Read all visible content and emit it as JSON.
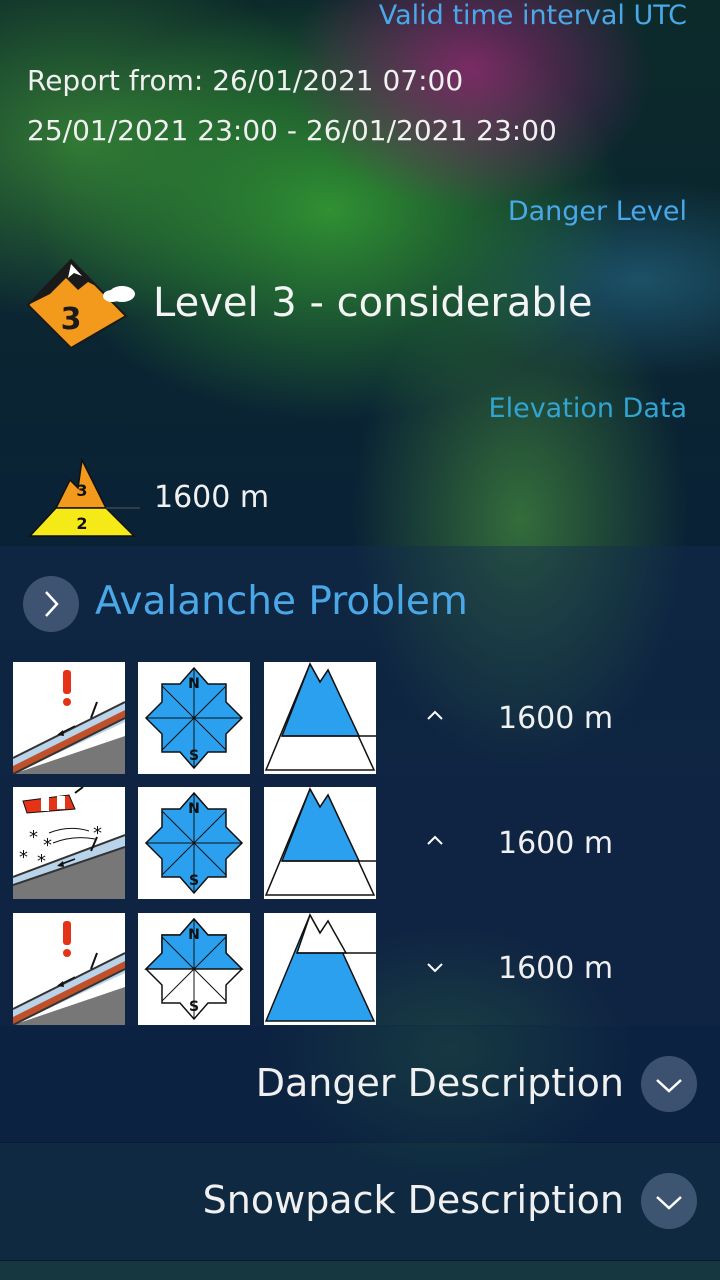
{
  "header": {
    "valid_interval_link": "Valid time interval UTC",
    "report_from": "Report from: 26/01/2021 07:00",
    "interval": "25/01/2021 23:00 - 26/01/2021 23:00",
    "danger_level_link": "Danger Level",
    "danger_level_number": "3",
    "danger_level_text": "Level 3 - considerable",
    "elevation_link": "Elevation Data",
    "elevation_upper_level": "3",
    "elevation_lower_level": "2",
    "elevation_value": "1600 m"
  },
  "avalanche_problem": {
    "title": "Avalanche Problem",
    "rows": [
      {
        "type_icon": "persistent-weak-layer-icon",
        "aspects": "all",
        "elevation_icon": "above-elevation",
        "direction_icon": "chevron-up-icon",
        "elevation": "1600 m",
        "compass_n": "N",
        "compass_s": "S"
      },
      {
        "type_icon": "wind-slab-icon",
        "aspects": "all",
        "elevation_icon": "above-elevation",
        "direction_icon": "chevron-up-icon",
        "elevation": "1600 m",
        "compass_n": "N",
        "compass_s": "S"
      },
      {
        "type_icon": "persistent-weak-layer-icon",
        "aspects": "north-sector",
        "elevation_icon": "below-elevation",
        "direction_icon": "chevron-down-icon",
        "elevation": "1600 m",
        "compass_n": "N",
        "compass_s": "S"
      }
    ]
  },
  "sections": {
    "danger_description": "Danger Description",
    "snowpack_description": "Snowpack Description"
  },
  "colors": {
    "link_blue": "#4aa8e8",
    "level3_orange": "#f39a1d",
    "level2_yellow": "#f5ea17",
    "aspect_blue": "#2aa0ee"
  }
}
